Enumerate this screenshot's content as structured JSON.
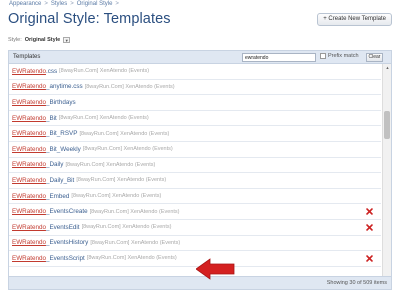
{
  "breadcrumb": [
    "Appearance",
    "Styles",
    "Original Style"
  ],
  "title": "Original Style: Templates",
  "create_button": "+ Create New Template",
  "style_selector": {
    "label": "Style:",
    "value": "Original Style"
  },
  "panel": {
    "header_label": "Templates",
    "filter_value": "ewratendo",
    "prefix_match_label": "Prefix match",
    "clear_label": "Clear"
  },
  "templates": [
    {
      "prefix": "EWRatendo",
      "rest": ".css",
      "addon": "[8wayRun.Com] XenAtendo (Events)",
      "deletable": false
    },
    {
      "prefix": "EWRatendo",
      "rest": "_anytime.css",
      "addon": "[8wayRun.Com] XenAtendo (Events)",
      "deletable": false
    },
    {
      "prefix": "EWRatendo",
      "rest": "_Birthdays",
      "addon": "",
      "deletable": false
    },
    {
      "prefix": "EWRatendo",
      "rest": "_Bit",
      "addon": "[8wayRun.Com] XenAtendo (Events)",
      "deletable": false
    },
    {
      "prefix": "EWRatendo",
      "rest": "_Bit_RSVP",
      "addon": "[8wayRun.Com] XenAtendo (Events)",
      "deletable": false
    },
    {
      "prefix": "EWRatendo",
      "rest": "_Bit_Weekly",
      "addon": "[8wayRun.Com] XenAtendo (Events)",
      "deletable": false
    },
    {
      "prefix": "EWRatendo",
      "rest": "_Daily",
      "addon": "[8wayRun.Com] XenAtendo (Events)",
      "deletable": false
    },
    {
      "prefix": "EWRatendo",
      "rest": "_Daily_Bit",
      "addon": "[8wayRun.Com] XenAtendo (Events)",
      "deletable": false
    },
    {
      "prefix": "EWRatendo",
      "rest": "_Embed",
      "addon": "[8wayRun.Com] XenAtendo (Events)",
      "deletable": false
    },
    {
      "prefix": "EWRatendo",
      "rest": "_EventsCreate",
      "addon": "[8wayRun.Com] XenAtendo (Events)",
      "deletable": true
    },
    {
      "prefix": "EWRatendo",
      "rest": "_EventsEdit",
      "addon": "[8wayRun.Com] XenAtendo (Events)",
      "deletable": true
    },
    {
      "prefix": "EWRatendo",
      "rest": "_EventsHistory",
      "addon": "[8wayRun.Com] XenAtendo (Events)",
      "deletable": false
    },
    {
      "prefix": "EWRatendo",
      "rest": "_EventsScript",
      "addon": "[8wayRun.Com] XenAtendo (Events)",
      "deletable": true
    }
  ],
  "footer": {
    "count_text": "Showing 30 of 509 items"
  },
  "colors": {
    "link": "#3b5f90",
    "prefix": "#c23a2f",
    "header_bg": "#dfe7f2",
    "arrow": "#d42020",
    "delete": "#cc2222"
  },
  "icons": {
    "delete": "delete-icon",
    "annotation": "red-arrow-icon"
  }
}
